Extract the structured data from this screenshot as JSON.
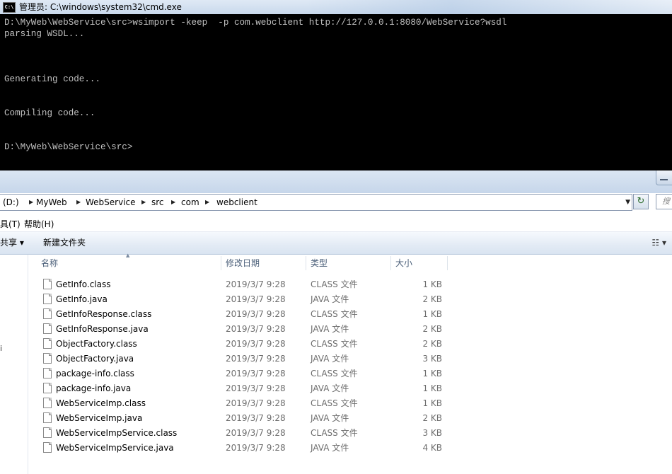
{
  "cmd": {
    "icon_text": "C:\\",
    "title": "管理员: C:\\windows\\system32\\cmd.exe",
    "lines": [
      "D:\\MyWeb\\WebService\\src>wsimport -keep  -p com.webclient http://127.0.0.1:8080/WebService?wsdl",
      "parsing WSDL...",
      "Generating code...",
      "Compiling code...",
      "D:\\MyWeb\\WebService\\src>"
    ]
  },
  "explorer": {
    "address": {
      "crumbs": [
        "(D:)",
        "MyWeb",
        "WebService",
        "src",
        "com",
        "webclient"
      ],
      "separator": "▶",
      "dropdown": "▼"
    },
    "refresh_icon": "↻",
    "search_placeholder": "搜",
    "menu": [
      "具(T)",
      "帮助(H)"
    ],
    "toolbar": {
      "share": "共享 ▾",
      "new_folder": "新建文件夹",
      "view": "☷ ▾"
    },
    "nav_fragment": "i",
    "columns": {
      "name": "名称",
      "date": "修改日期",
      "type": "类型",
      "size": "大小"
    },
    "files": [
      {
        "name": "GetInfo.class",
        "date": "2019/3/7 9:28",
        "type": "CLASS 文件",
        "size": "1 KB"
      },
      {
        "name": "GetInfo.java",
        "date": "2019/3/7 9:28",
        "type": "JAVA 文件",
        "size": "2 KB"
      },
      {
        "name": "GetInfoResponse.class",
        "date": "2019/3/7 9:28",
        "type": "CLASS 文件",
        "size": "1 KB"
      },
      {
        "name": "GetInfoResponse.java",
        "date": "2019/3/7 9:28",
        "type": "JAVA 文件",
        "size": "2 KB"
      },
      {
        "name": "ObjectFactory.class",
        "date": "2019/3/7 9:28",
        "type": "CLASS 文件",
        "size": "2 KB"
      },
      {
        "name": "ObjectFactory.java",
        "date": "2019/3/7 9:28",
        "type": "JAVA 文件",
        "size": "3 KB"
      },
      {
        "name": "package-info.class",
        "date": "2019/3/7 9:28",
        "type": "CLASS 文件",
        "size": "1 KB"
      },
      {
        "name": "package-info.java",
        "date": "2019/3/7 9:28",
        "type": "JAVA 文件",
        "size": "1 KB"
      },
      {
        "name": "WebServiceImp.class",
        "date": "2019/3/7 9:28",
        "type": "CLASS 文件",
        "size": "1 KB"
      },
      {
        "name": "WebServiceImp.java",
        "date": "2019/3/7 9:28",
        "type": "JAVA 文件",
        "size": "2 KB"
      },
      {
        "name": "WebServiceImpService.class",
        "date": "2019/3/7 9:28",
        "type": "CLASS 文件",
        "size": "3 KB"
      },
      {
        "name": "WebServiceImpService.java",
        "date": "2019/3/7 9:28",
        "type": "JAVA 文件",
        "size": "4 KB"
      }
    ]
  }
}
